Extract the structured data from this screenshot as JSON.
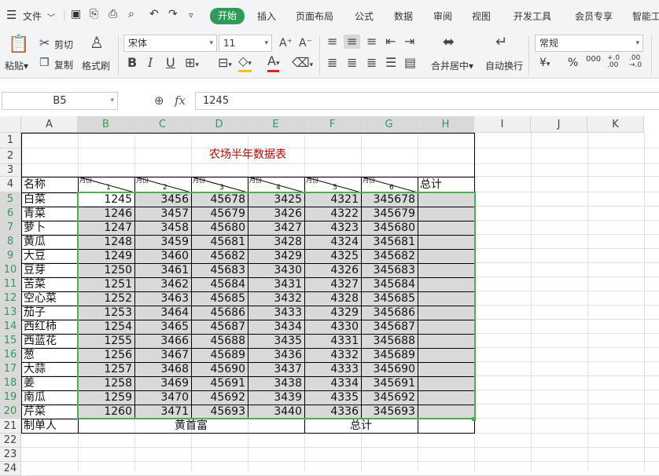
{
  "menu": {
    "file_label": "文件",
    "tabs": [
      "开始",
      "插入",
      "页面布局",
      "公式",
      "数据",
      "审阅",
      "视图",
      "开发工具",
      "会员专享",
      "智能工"
    ]
  },
  "ribbon": {
    "paste": "粘贴",
    "cut": "剪切",
    "copy": "复制",
    "format_painter": "格式刷",
    "font_name": "宋体",
    "font_size": "11",
    "merge_center": "合并居中",
    "wrap_text": "自动换行",
    "number_format": "常规",
    "currency_symbol": "¥",
    "percent_symbol": "%",
    "thousands": "000",
    "dec_inc": "+.0 .00",
    "dec_dec": ".00 →.0"
  },
  "formula_bar": {
    "name_box": "B5",
    "fx_label": "fx",
    "value": "1245"
  },
  "columns": [
    "A",
    "B",
    "C",
    "D",
    "E",
    "F",
    "G",
    "H",
    "I",
    "J",
    "K"
  ],
  "rows": [
    "1",
    "2",
    "3",
    "4",
    "5",
    "6",
    "7",
    "8",
    "9",
    "10",
    "11",
    "12",
    "13",
    "14",
    "15",
    "16",
    "17",
    "18",
    "19",
    "20",
    "21",
    "22",
    "23",
    "24"
  ],
  "sheet": {
    "title": "农场半年数据表",
    "header_name": "名称",
    "header_total": "总计",
    "diag_top": "月份",
    "months": [
      "1",
      "2",
      "3",
      "4",
      "5",
      "6"
    ],
    "items": [
      {
        "name": "白菜",
        "v": [
          1245,
          3456,
          45678,
          3425,
          4321,
          345678
        ]
      },
      {
        "name": "青菜",
        "v": [
          1246,
          3457,
          45679,
          3426,
          4322,
          345679
        ]
      },
      {
        "name": "萝卜",
        "v": [
          1247,
          3458,
          45680,
          3427,
          4323,
          345680
        ]
      },
      {
        "name": "黄瓜",
        "v": [
          1248,
          3459,
          45681,
          3428,
          4324,
          345681
        ]
      },
      {
        "name": "大豆",
        "v": [
          1249,
          3460,
          45682,
          3429,
          4325,
          345682
        ]
      },
      {
        "name": "豆芽",
        "v": [
          1250,
          3461,
          45683,
          3430,
          4326,
          345683
        ]
      },
      {
        "name": "苦菜",
        "v": [
          1251,
          3462,
          45684,
          3431,
          4327,
          345684
        ]
      },
      {
        "name": "空心菜",
        "v": [
          1252,
          3463,
          45685,
          3432,
          4328,
          345685
        ]
      },
      {
        "name": "茄子",
        "v": [
          1253,
          3464,
          45686,
          3433,
          4329,
          345686
        ]
      },
      {
        "name": "西红柿",
        "v": [
          1254,
          3465,
          45687,
          3434,
          4330,
          345687
        ]
      },
      {
        "name": "西蓝花",
        "v": [
          1255,
          3466,
          45688,
          3435,
          4331,
          345688
        ]
      },
      {
        "name": "葱",
        "v": [
          1256,
          3467,
          45689,
          3436,
          4332,
          345689
        ]
      },
      {
        "name": "大蒜",
        "v": [
          1257,
          3468,
          45690,
          3437,
          4333,
          345690
        ]
      },
      {
        "name": "姜",
        "v": [
          1258,
          3469,
          45691,
          3438,
          4334,
          345691
        ]
      },
      {
        "name": "南瓜",
        "v": [
          1259,
          3470,
          45692,
          3439,
          4335,
          345692
        ]
      },
      {
        "name": "芹菜",
        "v": [
          1260,
          3471,
          45693,
          3440,
          4336,
          345693
        ]
      }
    ],
    "footer_label": "制单人",
    "footer_person": "黄首富",
    "footer_total": "总计"
  }
}
